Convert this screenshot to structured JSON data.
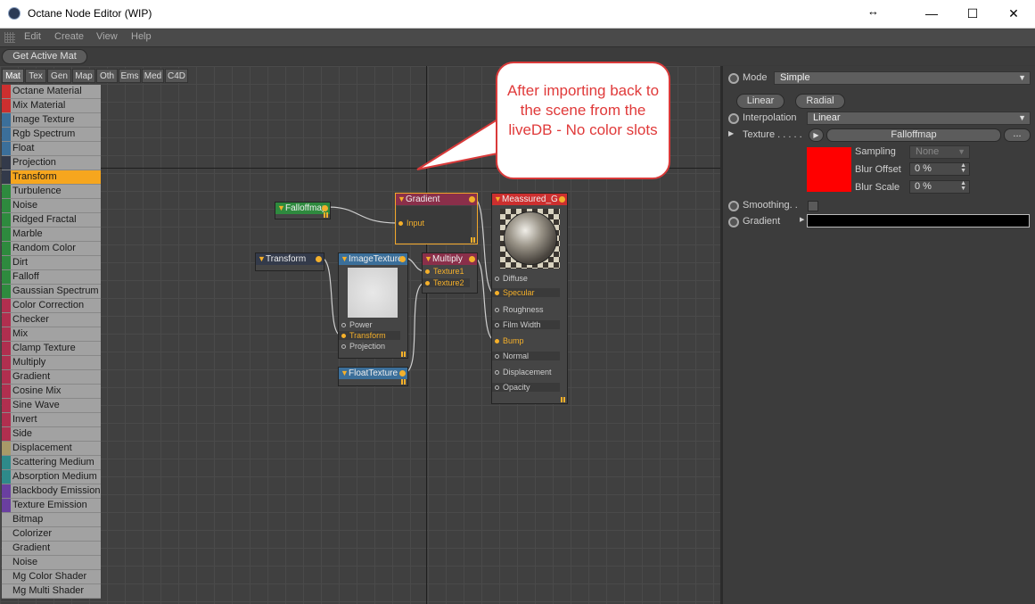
{
  "window": {
    "title": "Octane Node Editor (WIP)",
    "minimize": "—",
    "maximize": "☐",
    "close": "✕",
    "resize_glyph": "↔"
  },
  "menu": {
    "items": [
      "Edit",
      "Create",
      "View",
      "Help"
    ]
  },
  "toolbar": {
    "get_active_mat": "Get Active Mat"
  },
  "tabs": [
    "Mat",
    "Tex",
    "Gen",
    "Map",
    "Oth",
    "Ems",
    "Med",
    "C4D"
  ],
  "node_list": [
    {
      "label": "Octane Material",
      "color": "#cc2f2f"
    },
    {
      "label": "Mix Material",
      "color": "#cc2f2f"
    },
    {
      "label": "Image Texture",
      "color": "#3b6f9a"
    },
    {
      "label": "Rgb Spectrum",
      "color": "#3b6f9a"
    },
    {
      "label": "Float",
      "color": "#3b6f9a"
    },
    {
      "label": "Projection",
      "color": "#333a4a"
    },
    {
      "label": "Transform",
      "color": "#333a4a",
      "selected": true
    },
    {
      "label": "Turbulence",
      "color": "#2e8a3e"
    },
    {
      "label": "Noise",
      "color": "#2e8a3e"
    },
    {
      "label": "Ridged Fractal",
      "color": "#2e8a3e"
    },
    {
      "label": "Marble",
      "color": "#2e8a3e"
    },
    {
      "label": "Random Color",
      "color": "#2e8a3e"
    },
    {
      "label": "Dirt",
      "color": "#2e8a3e"
    },
    {
      "label": "Falloff",
      "color": "#2e8a3e"
    },
    {
      "label": "Gaussian Spectrum",
      "color": "#2e8a3e"
    },
    {
      "label": "Color Correction",
      "color": "#b02f4f"
    },
    {
      "label": "Checker",
      "color": "#b02f4f"
    },
    {
      "label": "Mix",
      "color": "#b02f4f"
    },
    {
      "label": "Clamp Texture",
      "color": "#b02f4f"
    },
    {
      "label": "Multiply",
      "color": "#b02f4f"
    },
    {
      "label": "Gradient",
      "color": "#b02f4f"
    },
    {
      "label": "Cosine Mix",
      "color": "#b02f4f"
    },
    {
      "label": "Sine Wave",
      "color": "#b02f4f"
    },
    {
      "label": "Invert",
      "color": "#b02f4f"
    },
    {
      "label": "Side",
      "color": "#b02f4f"
    },
    {
      "label": "Displacement",
      "color": "#a89a68"
    },
    {
      "label": "Scattering Medium",
      "color": "#2e8a8a"
    },
    {
      "label": "Absorption Medium",
      "color": "#2e8a8a"
    },
    {
      "label": "Blackbody Emission",
      "color": "#6a3fa0"
    },
    {
      "label": "Texture Emission",
      "color": "#6a3fa0"
    },
    {
      "label": "Bitmap",
      "color": "#a2a2a2"
    },
    {
      "label": "Colorizer",
      "color": "#a2a2a2"
    },
    {
      "label": "Gradient",
      "color": "#a2a2a2"
    },
    {
      "label": "Noise",
      "color": "#a2a2a2"
    },
    {
      "label": "Mg Color Shader",
      "color": "#a2a2a2"
    },
    {
      "label": "Mg Multi Shader",
      "color": "#a2a2a2"
    }
  ],
  "graph": {
    "falloffmap": {
      "title": "Falloffmap",
      "color": "#2e8a3e"
    },
    "gradient": {
      "title": "Gradient",
      "color": "#8a2f4a",
      "input": "Input"
    },
    "measured": {
      "title": "Meassured_G",
      "color": "#cc2f2f",
      "ports": [
        "Diffuse",
        "Specular",
        "Roughness",
        "Film Width",
        "Bump",
        "Normal",
        "Displacement",
        "Opacity"
      ]
    },
    "transform": {
      "title": "Transform",
      "color": "#333a4a"
    },
    "imagetexture": {
      "title": "ImageTexture",
      "color": "#3b6f9a",
      "ports": [
        "Power",
        "Transform",
        "Projection"
      ]
    },
    "multiply": {
      "title": "Multiply",
      "color": "#8a2f4a",
      "ports": [
        "Texture1",
        "Texture2"
      ]
    },
    "floattexture": {
      "title": "FloatTexture",
      "color": "#3b6f9a"
    }
  },
  "callout": {
    "text": "After importing back to the scene from the liveDB - No color slots"
  },
  "properties": {
    "mode_label": "Mode",
    "mode_value": "Simple",
    "linear_button": "Linear",
    "radial_button": "Radial",
    "interpolation_label": "Interpolation",
    "interpolation_value": "Linear",
    "texture_label": "Texture . . . . .",
    "texture_value": "Falloffmap",
    "more_button": "...",
    "sampling_label": "Sampling",
    "sampling_value": "None",
    "blur_offset_label": "Blur Offset",
    "blur_offset_value": "0 %",
    "blur_scale_label": "Blur Scale",
    "blur_scale_value": "0 %",
    "smoothing_label": "Smoothing. .",
    "gradient_label": "Gradient",
    "swatch_color": "#ff0000"
  }
}
